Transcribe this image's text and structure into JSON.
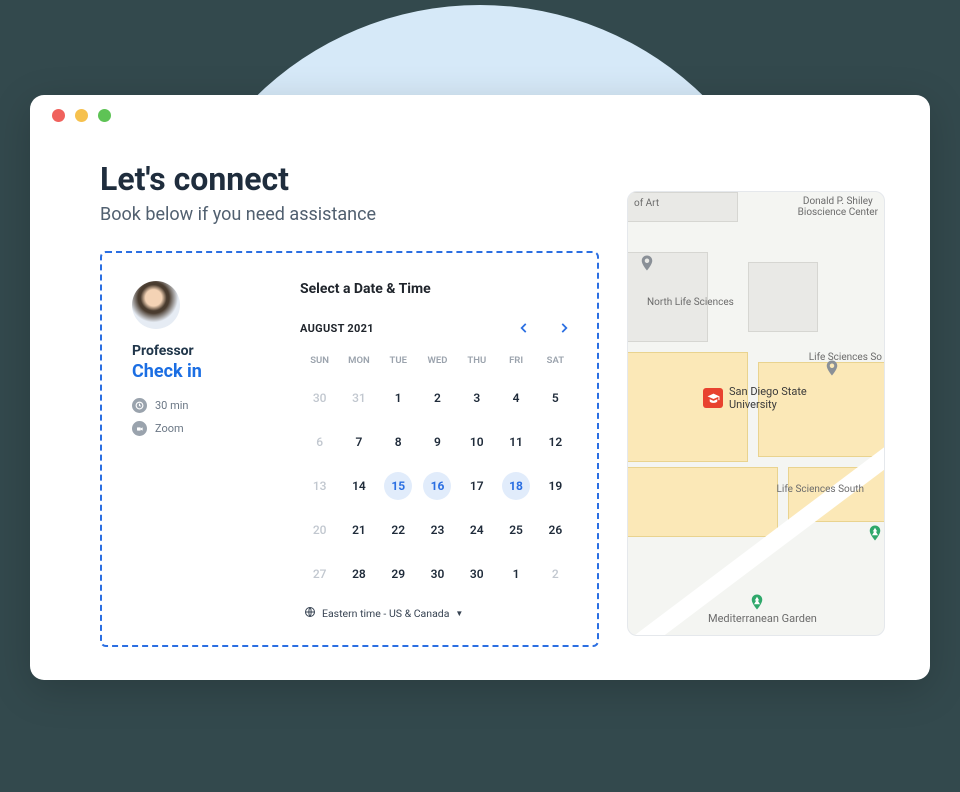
{
  "header": {
    "title": "Let's connect",
    "subtitle": "Book below if you need assistance"
  },
  "booking": {
    "title": "Select a Date & Time",
    "host_label": "Professor",
    "event_name": "Check in",
    "duration": "30 min",
    "location": "Zoom",
    "month_label": "AUGUST 2021",
    "dow": [
      "SUN",
      "MON",
      "TUE",
      "WED",
      "THU",
      "FRI",
      "SAT"
    ],
    "days": [
      {
        "n": "30",
        "muted": true
      },
      {
        "n": "31",
        "muted": true
      },
      {
        "n": "1"
      },
      {
        "n": "2"
      },
      {
        "n": "3"
      },
      {
        "n": "4"
      },
      {
        "n": "5"
      },
      {
        "n": "6",
        "muted": true
      },
      {
        "n": "7"
      },
      {
        "n": "8"
      },
      {
        "n": "9"
      },
      {
        "n": "10"
      },
      {
        "n": "11"
      },
      {
        "n": "12"
      },
      {
        "n": "13",
        "muted": true
      },
      {
        "n": "14"
      },
      {
        "n": "15",
        "avail": true
      },
      {
        "n": "16",
        "avail": true
      },
      {
        "n": "17"
      },
      {
        "n": "18",
        "avail": true
      },
      {
        "n": "19"
      },
      {
        "n": "20",
        "muted": true
      },
      {
        "n": "21"
      },
      {
        "n": "22"
      },
      {
        "n": "23"
      },
      {
        "n": "24"
      },
      {
        "n": "25"
      },
      {
        "n": "26"
      },
      {
        "n": "27",
        "muted": true
      },
      {
        "n": "28"
      },
      {
        "n": "29"
      },
      {
        "n": "30"
      },
      {
        "n": "30"
      },
      {
        "n": "1"
      },
      {
        "n": "2",
        "muted": true
      }
    ],
    "timezone": "Eastern time - US & Canada"
  },
  "map": {
    "labels": {
      "art": "of Art",
      "shiley": "Donald P. Shiley\nBioscience Center",
      "north_ls": "North Life Sciences",
      "ls_so": "Life Sciences So",
      "university": "San Diego State\nUniversity",
      "ls_south": "Life Sciences South",
      "garden": "Mediterranean Garden"
    }
  }
}
